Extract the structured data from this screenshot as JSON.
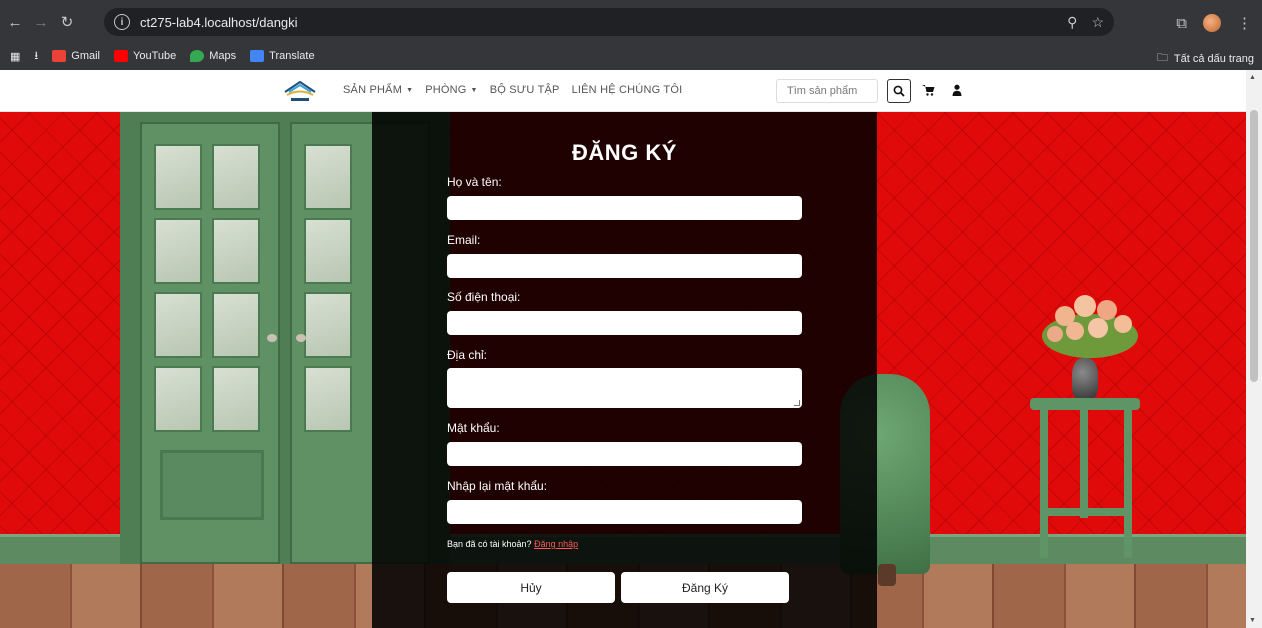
{
  "browser": {
    "url": "ct275-lab4.localhost/dangki",
    "bookmarks": [
      {
        "label": "Gmail",
        "color": "#ea4335"
      },
      {
        "label": "YouTube",
        "color": "#ff0000"
      },
      {
        "label": "Maps",
        "color": "#34a853"
      },
      {
        "label": "Translate",
        "color": "#4285f4"
      }
    ],
    "all_bookmarks_label": "Tất cả dấu trang"
  },
  "site": {
    "menu": [
      {
        "label": "SẢN PHẨM",
        "has_dropdown": true
      },
      {
        "label": "PHÒNG",
        "has_dropdown": true
      },
      {
        "label": "BỘ SƯU TẬP",
        "has_dropdown": false
      },
      {
        "label": "LIÊN HỆ CHÚNG TÔI",
        "has_dropdown": false
      }
    ],
    "search_placeholder": "Tìm sản phẩm",
    "icons": [
      "search-icon",
      "cart-icon",
      "user-icon"
    ]
  },
  "form": {
    "title": "ĐĂNG KÝ",
    "fields": {
      "fullname": "Họ và tên:",
      "email": "Email:",
      "phone": "Số điện thoại:",
      "address": "Địa chỉ:",
      "password": "Mật khẩu:",
      "confirm": "Nhập lại mật khẩu:"
    },
    "login_prompt": "Bạn đã có tài khoản?",
    "login_link": "Đăng nhập",
    "cancel_label": "Hủy",
    "submit_label": "Đăng Ký"
  },
  "colors": {
    "wall": "#e00a0a",
    "panel": "#000000",
    "link": "#ff5a5a"
  }
}
